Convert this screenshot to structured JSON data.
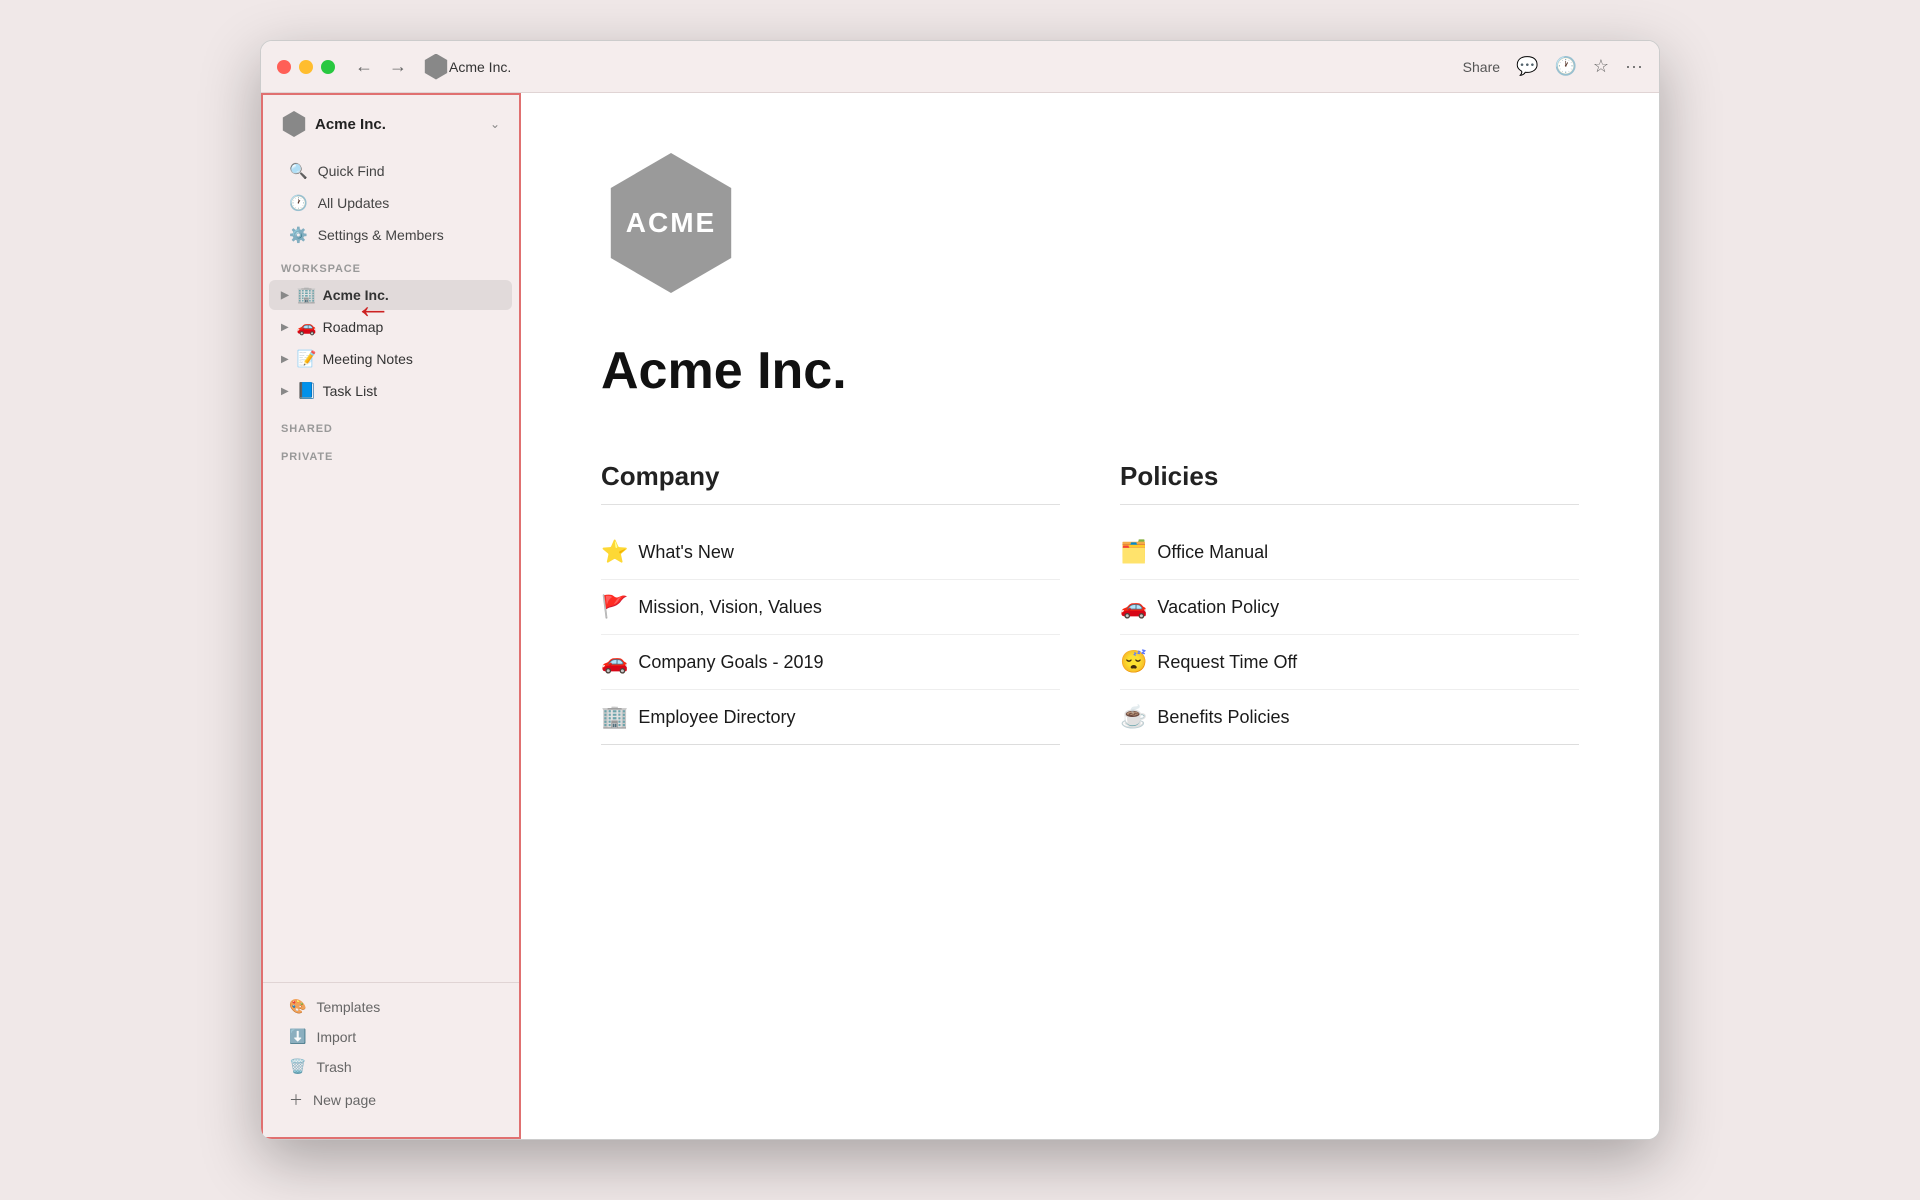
{
  "window": {
    "title": "Acme Inc."
  },
  "titlebar": {
    "workspace_name": "Acme Inc.",
    "share_label": "Share",
    "more_label": "···"
  },
  "sidebar": {
    "workspace_name": "Acme Inc.",
    "quick_find": "Quick Find",
    "all_updates": "All Updates",
    "settings": "Settings & Members",
    "workspace_label": "WORKSPACE",
    "shared_label": "SHARED",
    "private_label": "PRIVATE",
    "tree_items": [
      {
        "icon": "🏢",
        "label": "Acme Inc.",
        "active": true
      },
      {
        "icon": "🚗",
        "label": "Roadmap",
        "active": false
      },
      {
        "icon": "📝",
        "label": "Meeting Notes",
        "active": false
      },
      {
        "icon": "📘",
        "label": "Task List",
        "active": false
      }
    ],
    "templates_label": "Templates",
    "import_label": "Import",
    "trash_label": "Trash",
    "new_page_label": "New page"
  },
  "content": {
    "logo_text": "ACME",
    "page_title": "Acme Inc.",
    "company_heading": "Company",
    "policies_heading": "Policies",
    "company_links": [
      {
        "emoji": "⭐",
        "label": "What's New"
      },
      {
        "emoji": "🚩",
        "label": "Mission, Vision, Values"
      },
      {
        "emoji": "🚗",
        "label": "Company Goals - 2019"
      },
      {
        "emoji": "🏢",
        "label": "Employee Directory"
      }
    ],
    "policy_links": [
      {
        "emoji": "🗂️",
        "label": "Office Manual"
      },
      {
        "emoji": "🚗",
        "label": "Vacation Policy"
      },
      {
        "emoji": "😴",
        "label": "Request Time Off"
      },
      {
        "emoji": "☕",
        "label": "Benefits Policies"
      }
    ]
  }
}
